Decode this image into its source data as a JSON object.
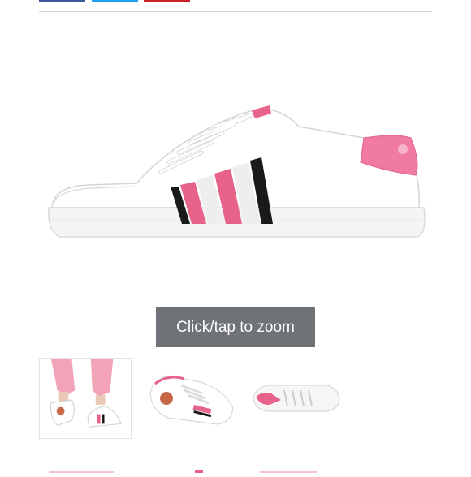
{
  "share_bar": {
    "buttons": [
      {
        "name": "facebook",
        "color": "#3b5998"
      },
      {
        "name": "twitter",
        "color": "#1da1f2"
      },
      {
        "name": "pinterest",
        "color": "#cb2027"
      }
    ]
  },
  "product": {
    "main_image_alt": "white leather low-top sneaker with pink, white and black side stripes and pink heel tab",
    "zoom_label": "Click/tap to zoom",
    "accent_color": "#e8638a",
    "thumbnails": [
      {
        "alt": "sneakers worn with pink jogger pants"
      },
      {
        "alt": "top view of sneaker with embroidered heart patch"
      },
      {
        "alt": "sole view of sneaker"
      }
    ]
  }
}
